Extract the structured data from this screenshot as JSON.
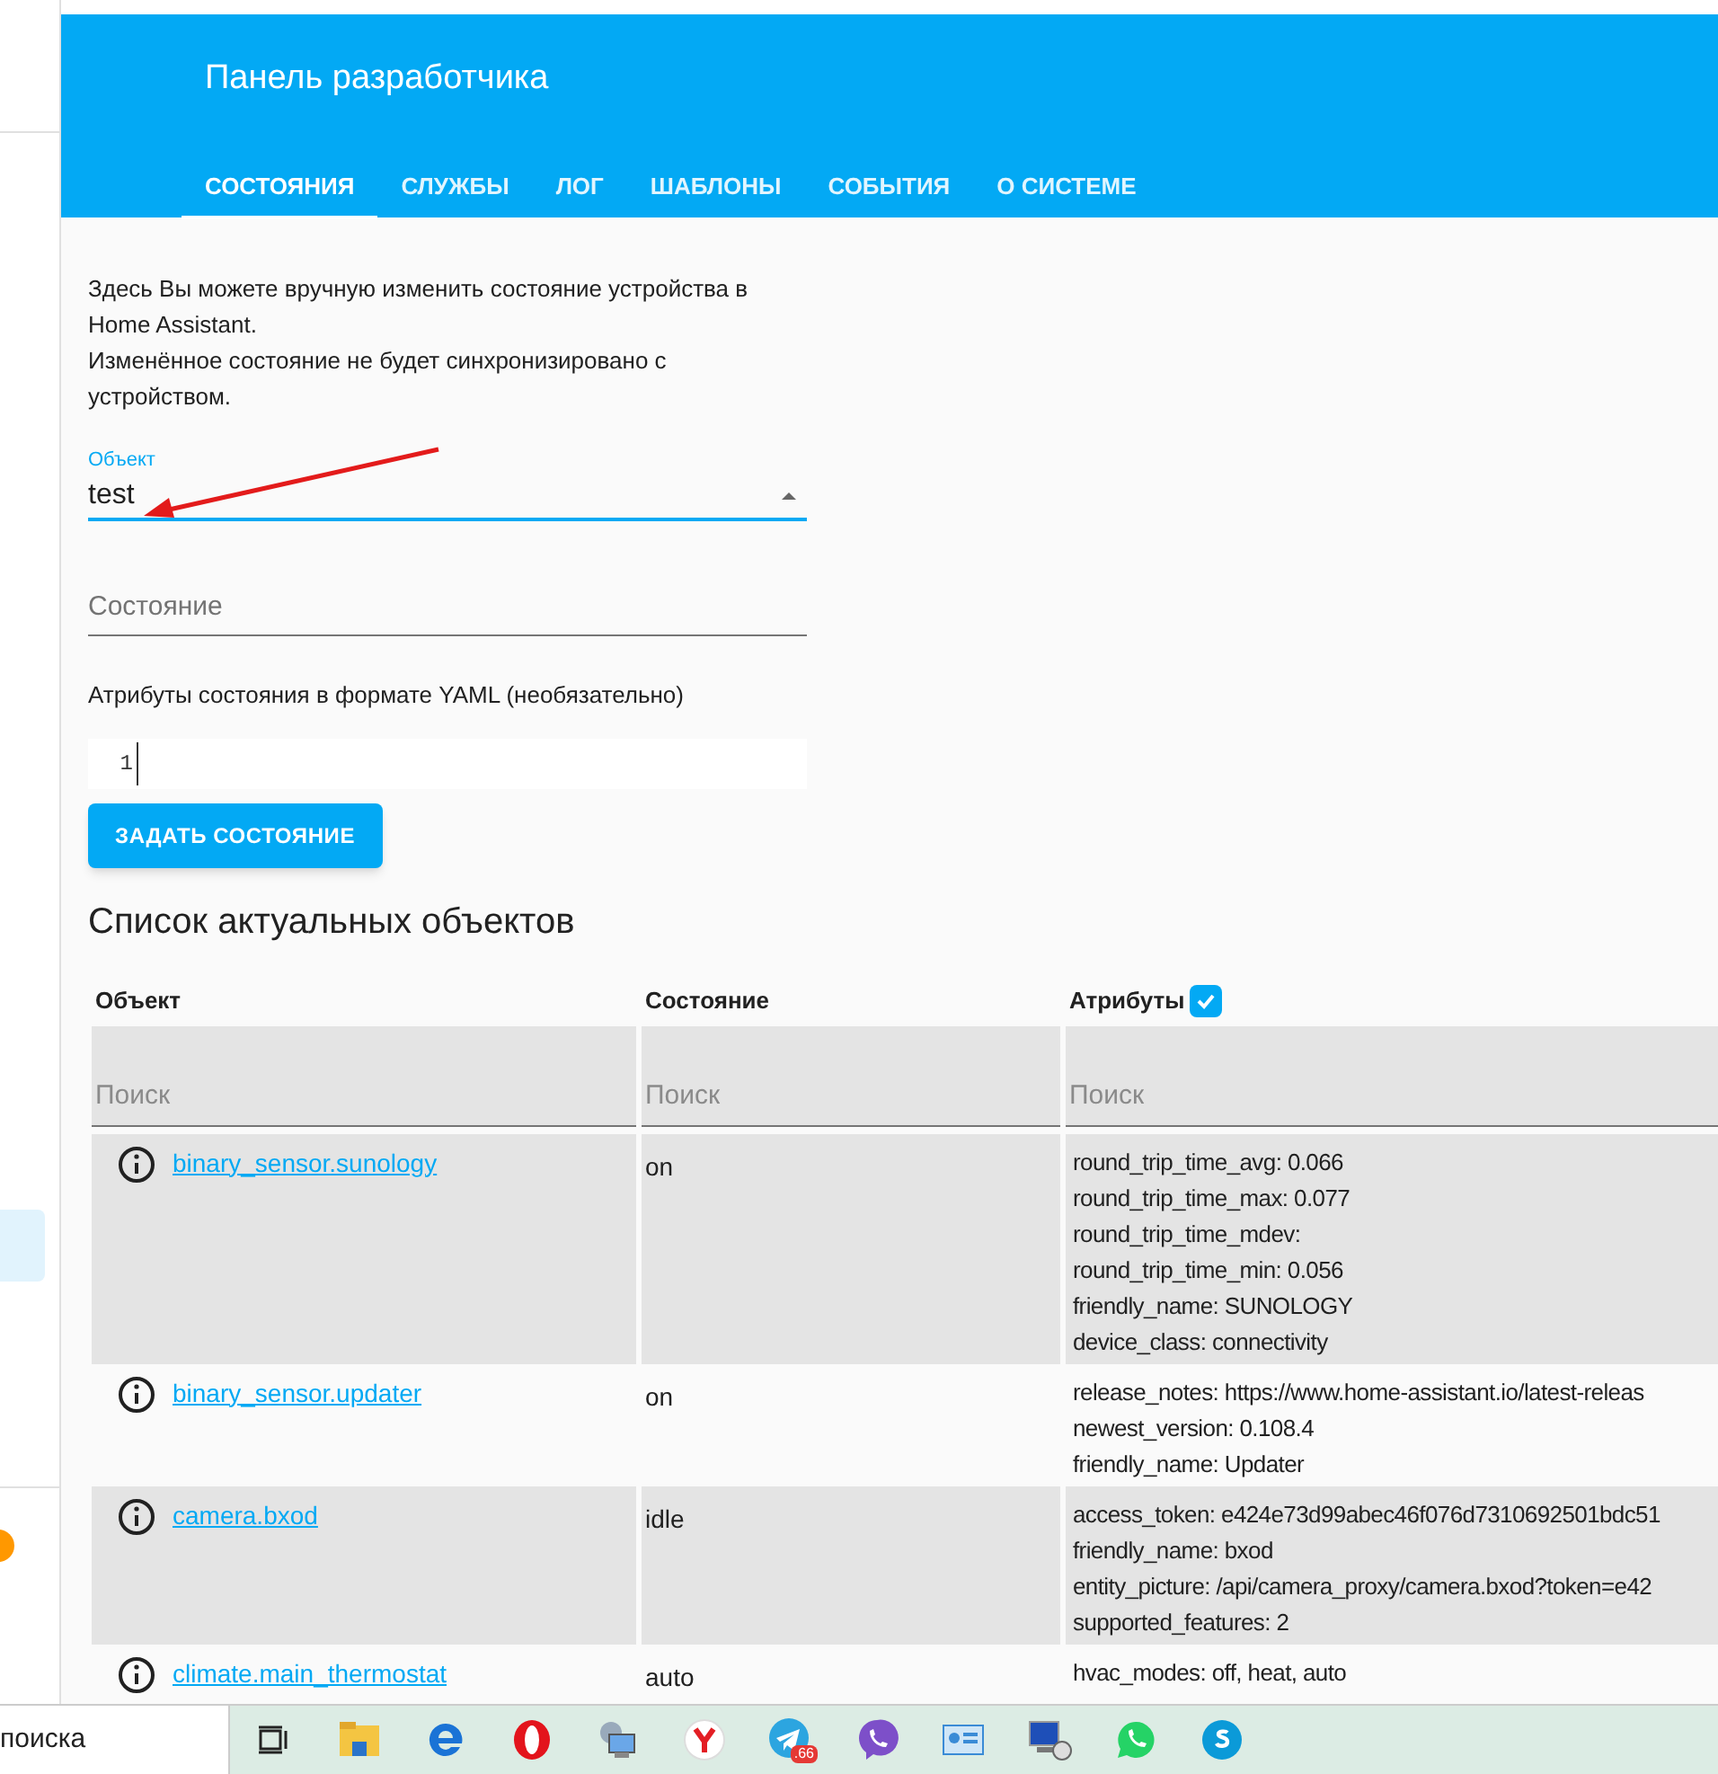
{
  "header": {
    "title": "Панель разработчика"
  },
  "tabs": [
    {
      "label": "СОСТОЯНИЯ",
      "selected": true
    },
    {
      "label": "СЛУЖБЫ",
      "selected": false
    },
    {
      "label": "ЛОГ",
      "selected": false
    },
    {
      "label": "ШАБЛОНЫ",
      "selected": false
    },
    {
      "label": "СОБЫТИЯ",
      "selected": false
    },
    {
      "label": "О СИСТЕМЕ",
      "selected": false
    }
  ],
  "intro": [
    "Здесь Вы можете вручную изменить состояние устройства в Home Assistant.",
    "Изменённое состояние не будет синхронизировано с устройством."
  ],
  "entity_field": {
    "label": "Объект",
    "value": "test"
  },
  "state_field": {
    "placeholder": "Состояние"
  },
  "yaml": {
    "label": "Атрибуты состояния в формате YAML (необязательно)",
    "line_number": "1"
  },
  "set_button": "ЗАДАТЬ СОСТОЯНИЕ",
  "list_title": "Список актуальных объектов",
  "table": {
    "columns": [
      "Объект",
      "Состояние",
      "Атрибуты"
    ],
    "attributes_checked": true,
    "search_placeholders": [
      "Поиск",
      "Поиск",
      "Поиск"
    ],
    "rows": [
      {
        "entity": "binary_sensor.sunology",
        "state": "on",
        "attributes": [
          "round_trip_time_avg: 0.066",
          "round_trip_time_max: 0.077",
          "round_trip_time_mdev:",
          "round_trip_time_min: 0.056",
          "friendly_name: SUNOLOGY",
          "device_class: connectivity"
        ]
      },
      {
        "entity": "binary_sensor.updater",
        "state": "on",
        "attributes": [
          "release_notes: https://www.home-assistant.io/latest-releas",
          "newest_version: 0.108.4",
          "friendly_name: Updater"
        ]
      },
      {
        "entity": "camera.bxod",
        "state": "idle",
        "attributes": [
          "access_token: e424e73d99abec46f076d7310692501bdc51",
          "friendly_name: bxod",
          "entity_picture: /api/camera_proxy/camera.bxod?token=e42",
          "supported_features: 2"
        ]
      },
      {
        "entity": "climate.main_thermostat",
        "state": "auto",
        "attributes": [
          "hvac_modes: off, heat, auto"
        ]
      }
    ]
  },
  "taskbar": {
    "search_text": "поиска",
    "telegram_badge": ".66"
  }
}
